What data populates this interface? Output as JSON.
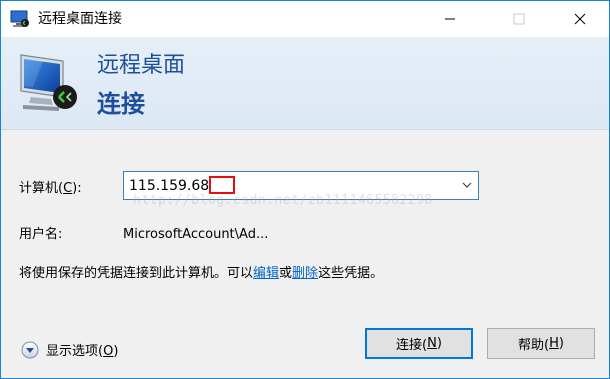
{
  "window": {
    "title": "远程桌面连接"
  },
  "banner": {
    "line1": "远程桌面",
    "line2": "连接"
  },
  "form": {
    "computer_label": "计算机(",
    "computer_access_key": "C",
    "computer_label_suffix": "):",
    "computer_value": "115.159.68",
    "username_label": "用户名:",
    "username_value": "MicrosoftAccount\\Ad...",
    "info_prefix": "将使用保存的凭据连接到此计算机。可以",
    "edit_link": "编辑",
    "info_or": "或",
    "delete_link": "删除",
    "info_suffix": "这些凭据。"
  },
  "watermark": "http://blog.csdn.net/zb1111465582298",
  "footer": {
    "show_options": "显示选项(",
    "show_options_key": "O",
    "show_options_suffix": ")",
    "connect_button": "连接(",
    "connect_key": "N",
    "connect_suffix": ")",
    "help_button": "帮助(",
    "help_key": "H",
    "help_suffix": ")"
  },
  "colors": {
    "window_border": "#1883d7",
    "banner_text": "#1c4f9c",
    "link": "#0066cc",
    "combo_border": "#3c7fb1",
    "primary_button_border": "#0078d7",
    "annotation_box": "#e01010"
  },
  "icons": [
    "rdp-app-icon",
    "minimize-icon",
    "maximize-icon",
    "close-icon",
    "rdp-monitor-icon",
    "dropdown-arrow-icon",
    "expand-options-icon"
  ]
}
